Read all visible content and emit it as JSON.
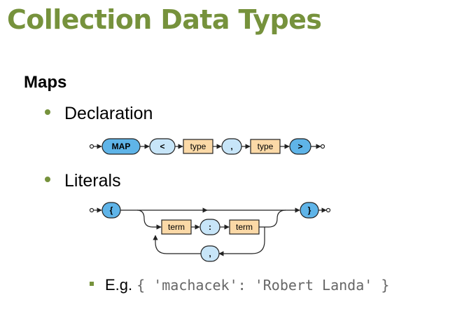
{
  "title": "Collection Data Types",
  "section": "Maps",
  "bullets": [
    {
      "label": "Declaration"
    },
    {
      "label": "Literals"
    }
  ],
  "example": {
    "label": "E.g.",
    "code": "{ 'machacek': 'Robert Landa' }"
  },
  "declaration_diagram": {
    "keyword": "MAP",
    "lt": "<",
    "type1": "type",
    "comma": ",",
    "type2": "type",
    "gt": ">"
  },
  "literals_diagram": {
    "open": "{",
    "term1": "term",
    "colon": ":",
    "term2": "term",
    "comma": ",",
    "close": "}"
  },
  "colors": {
    "accent": "#76923c",
    "terminal_fill": "#5fb4e8",
    "nonterminal_fill": "#fbd9a7"
  }
}
